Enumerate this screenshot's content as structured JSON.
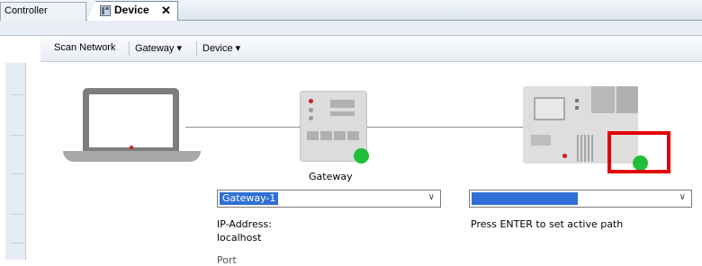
{
  "tabs": {
    "controller_label": "Controller",
    "device_label": "Device",
    "close_glyph": "✕"
  },
  "toolbar": {
    "scan_network": "Scan Network",
    "gateway_menu": "Gateway ▾",
    "device_menu": "Device ▾"
  },
  "gateway": {
    "caption": "Gateway",
    "selected": "Gateway-1",
    "ip_label": "IP-Address:",
    "ip_value": "localhost",
    "partial_label": "Port"
  },
  "device": {
    "selected": "                            ",
    "hint": "Press ENTER to set active path"
  },
  "colors": {
    "status_ok": "#1fbf3a",
    "highlight": "#e40000",
    "selection": "#2f6fd6"
  }
}
